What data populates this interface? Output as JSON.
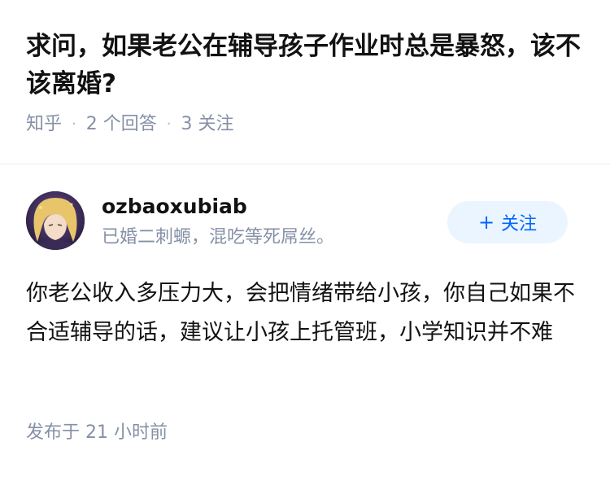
{
  "question": {
    "title": "求问，如果老公在辅导孩子作业时总是暴怒，该不该离婚?",
    "source": "知乎",
    "answers_count": "2",
    "answers_label": "个回答",
    "followers_count": "3",
    "followers_label": "关注"
  },
  "answer": {
    "author": {
      "name": "ozbaoxubiab",
      "bio": "已婚二刺螈，混吃等死屌丝。",
      "follow_label": "关注",
      "follow_icon": "plus-icon"
    },
    "content": "你老公收入多压力大，会把情绪带给小孩，你自己如果不合适辅导的话，建议让小孩上托管班，小学知识并不难",
    "time": "发布于  21 小时前"
  },
  "colors": {
    "primary_text": "#121212",
    "secondary_text": "#8590a6",
    "accent": "#0066ff",
    "accent_bg": "#ebf5ff"
  }
}
